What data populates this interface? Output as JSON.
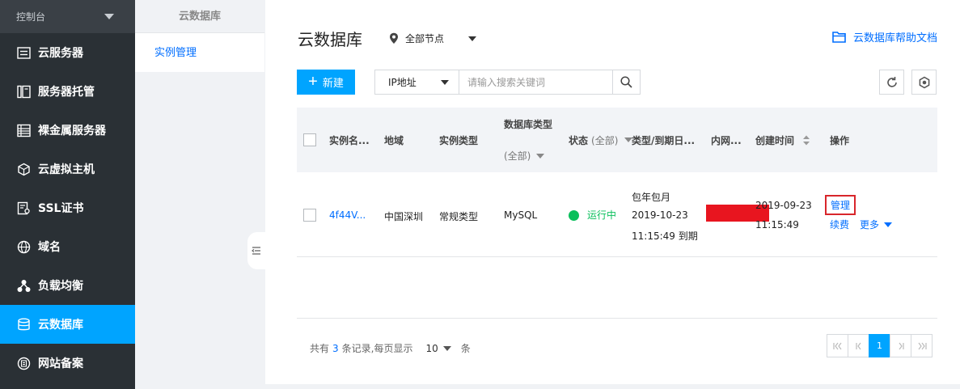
{
  "sidebar": {
    "header": "控制台",
    "items": [
      {
        "label": "云服务器",
        "icon": "server-icon"
      },
      {
        "label": "服务器托管",
        "icon": "hosting-icon"
      },
      {
        "label": "裸金属服务器",
        "icon": "bare-metal-icon"
      },
      {
        "label": "云虚拟主机",
        "icon": "cube-icon"
      },
      {
        "label": "SSL证书",
        "icon": "certificate-icon"
      },
      {
        "label": "域名",
        "icon": "globe-icon"
      },
      {
        "label": "负载均衡",
        "icon": "load-balancer-icon"
      },
      {
        "label": "云数据库",
        "icon": "database-icon",
        "active": true
      },
      {
        "label": "网站备案",
        "icon": "record-icon"
      }
    ]
  },
  "subnav": {
    "title": "云数据库",
    "items": [
      {
        "label": "实例管理"
      }
    ]
  },
  "main": {
    "title": "云数据库",
    "region": "全部节点",
    "help_link": "云数据库帮助文档",
    "new_button": "新建",
    "search": {
      "field": "IP地址",
      "placeholder": "请输入搜索关键词"
    }
  },
  "table": {
    "headers": {
      "name": "实例名...",
      "region": "地域",
      "instance_type": "实例类型",
      "db_type": "数据库类型",
      "db_type_filter": "(全部)",
      "status": "状态",
      "status_filter": "(全部)",
      "billing": "类型/到期日...",
      "intranet": "内网...",
      "created": "创建时间",
      "actions": "操作"
    },
    "rows": [
      {
        "name": "4f44V...",
        "region": "中国深圳",
        "instance_type": "常规类型",
        "db_type": "MySQL",
        "status": "运行中",
        "billing_line1": "包年包月",
        "billing_line2": "2019-10-23",
        "billing_line3": "11:15:49 到期",
        "created_date": "2019-09-23",
        "created_time": "11:15:49",
        "action_manage": "管理",
        "action_renew": "续费",
        "action_more": "更多"
      }
    ]
  },
  "pagination": {
    "prefix": "共有",
    "total": "3",
    "suffix": "条记录,每页显示",
    "page_size": "10",
    "unit": "条",
    "current_page": "1"
  },
  "colors": {
    "accent": "#00a4ff",
    "link": "#006eff",
    "running": "#0abf5b",
    "highlight_border": "#d8262b"
  }
}
